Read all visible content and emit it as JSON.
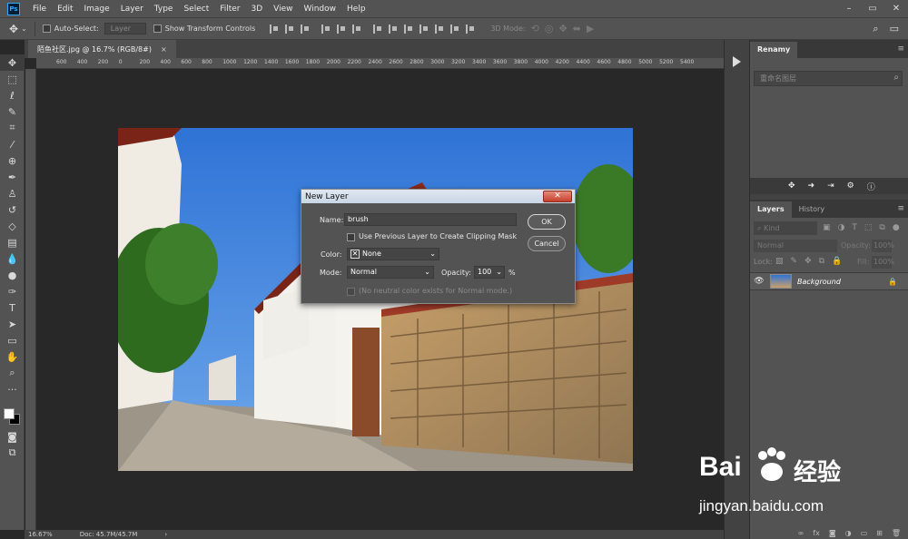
{
  "menubar": {
    "logo": "Ps",
    "items": [
      "File",
      "Edit",
      "Image",
      "Layer",
      "Type",
      "Select",
      "Filter",
      "3D",
      "View",
      "Window",
      "Help"
    ],
    "controls": [
      "–",
      "▭",
      "✕"
    ]
  },
  "options": {
    "auto_select_label": "Auto-Select:",
    "auto_select_target": "Layer",
    "transform_label": "Show Transform Controls",
    "mode_3d_label": "3D Mode:"
  },
  "document": {
    "tab_title": "陌鱼社区.jpg @ 16.7% (RGB/8#)",
    "close": "×"
  },
  "ruler": {
    "h_ticks": [
      "600",
      "400",
      "200",
      "0",
      "200",
      "400",
      "600",
      "800",
      "1000",
      "1200",
      "1400",
      "1600",
      "1800",
      "2000",
      "2200",
      "2400",
      "2600",
      "2800",
      "3000",
      "3200",
      "3400",
      "3600",
      "3800",
      "4000",
      "4200",
      "4400",
      "4600",
      "4800",
      "5000",
      "5200",
      "5400"
    ]
  },
  "status": {
    "zoom": "16.67%",
    "doc": "Doc: 45.7M/45.7M",
    "arrow": "›"
  },
  "renamy": {
    "tab": "Renamy",
    "placeholder": "重命名图层"
  },
  "layers_panel": {
    "tabs": [
      "Layers",
      "History"
    ],
    "filter_kind": "Kind",
    "blend_mode": "Normal",
    "opacity_label": "Opacity:",
    "opacity_value": "100%",
    "lock_label": "Lock:",
    "fill_label": "Fill:",
    "fill_value": "100%",
    "layer_name": "Background"
  },
  "dialog": {
    "title": "New Layer",
    "close": "✕",
    "name_label": "Name:",
    "name_value": "brush",
    "clip_label": "Use Previous Layer to Create Clipping Mask",
    "color_label": "Color:",
    "color_value": "None",
    "mode_label": "Mode:",
    "mode_value": "Normal",
    "opacity_label": "Opacity:",
    "opacity_value": "100",
    "percent": "%",
    "neutral_label": "(No neutral color exists for Normal mode.)",
    "ok_label": "OK",
    "cancel_label": "Cancel"
  },
  "watermark": {
    "brand": "Bai",
    "brand2": "经验",
    "url": "jingyan.baidu.com"
  }
}
